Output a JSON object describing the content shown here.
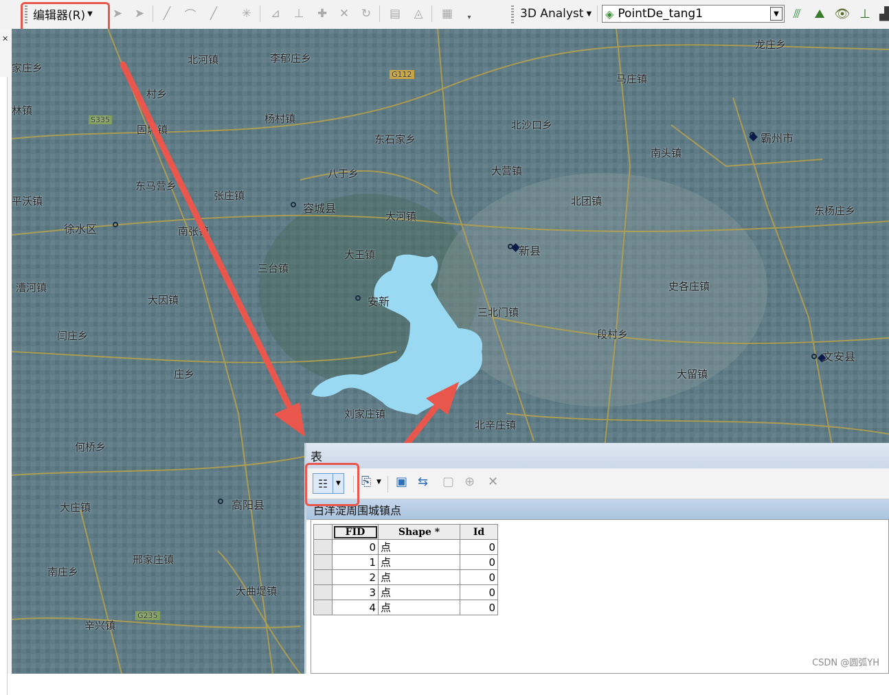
{
  "toolbar": {
    "editor_menu_label": "编辑器(R)",
    "analyst_menu_label": "3D Analyst",
    "layer_select_value": "PointDe_tang1"
  },
  "map": {
    "place_labels": [
      "北河镇",
      "李郁庄乡",
      "家庄乡",
      "村乡",
      "林镇",
      "固城镇",
      "杨村镇",
      "东马营乡",
      "北沙口乡",
      "霸州市",
      "平沃镇",
      "张庄镇",
      "南张镇",
      "容城县",
      "八于乡",
      "大营镇",
      "东石家乡",
      "大河镇",
      "徐水区",
      "大王镇",
      "三台镇",
      "安新",
      "新县",
      "三北门镇",
      "漕河镇",
      "大因镇",
      "闫庄乡",
      "庄乡",
      "刘家庄镇",
      "北辛庄镇",
      "何桥乡",
      "高阳县",
      "大庄镇",
      "邢家庄镇",
      "大曲堤镇",
      "辛兴镇",
      "文安县",
      "南庄乡",
      "大留镇",
      "史各庄镇",
      "段村乡",
      "龙庄乡",
      "马庄镇",
      "北团镇",
      "南头镇",
      "东杨庄乡"
    ],
    "road_labels": [
      "G112",
      "S335",
      "G235"
    ]
  },
  "table_window": {
    "title": "表",
    "tab_label": "白洋淀周围城镇点",
    "columns": [
      "FID",
      "Shape *",
      "Id"
    ],
    "rows": [
      {
        "fid": "0",
        "shape": "点",
        "id": "0"
      },
      {
        "fid": "1",
        "shape": "点",
        "id": "0"
      },
      {
        "fid": "2",
        "shape": "点",
        "id": "0"
      },
      {
        "fid": "3",
        "shape": "点",
        "id": "0"
      },
      {
        "fid": "4",
        "shape": "点",
        "id": "0"
      }
    ]
  },
  "watermark": "CSDN @圆弧YH",
  "colors": {
    "annotation_red": "#e9564c",
    "lake_fill": "#99d9f2",
    "road_yellow": "#b9a24a",
    "map_base": "#5f7b86"
  }
}
